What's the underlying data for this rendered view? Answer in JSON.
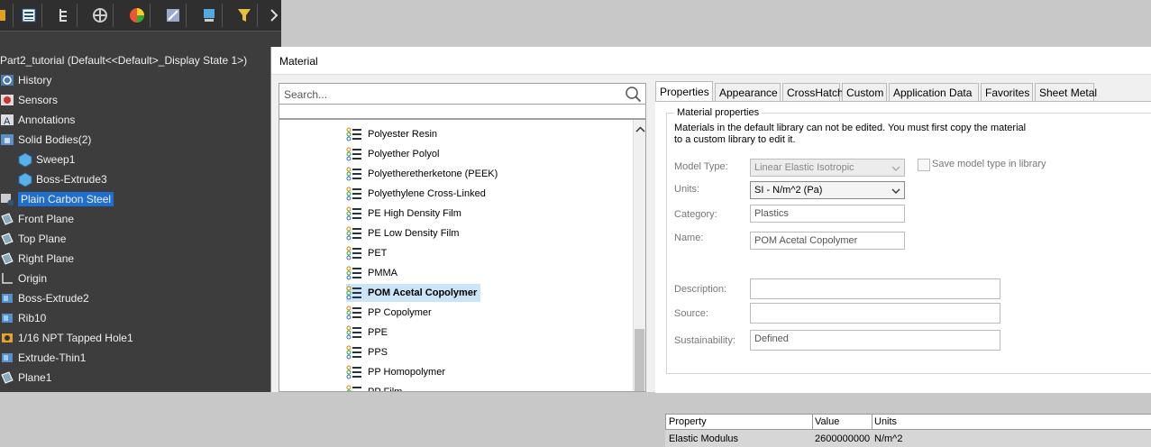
{
  "tree": {
    "part_title": "Part2_tutorial  (Default<<Default>_Display State 1>)",
    "items": [
      {
        "label": "History",
        "icon": "history-icon",
        "indent": 0
      },
      {
        "label": "Sensors",
        "icon": "sensor-icon",
        "indent": 0
      },
      {
        "label": "Annotations",
        "icon": "annotation-icon",
        "indent": 0
      },
      {
        "label": "Solid Bodies(2)",
        "icon": "solid-bodies-icon",
        "indent": 0
      },
      {
        "label": "Sweep1",
        "icon": "body-icon",
        "indent": 1
      },
      {
        "label": "Boss-Extrude3",
        "icon": "body-icon",
        "indent": 1
      },
      {
        "label": "Plain Carbon Steel",
        "icon": "material-icon",
        "indent": 0,
        "selected": true
      },
      {
        "label": "Front Plane",
        "icon": "plane-icon",
        "indent": 0
      },
      {
        "label": "Top Plane",
        "icon": "plane-icon",
        "indent": 0
      },
      {
        "label": "Right Plane",
        "icon": "plane-icon",
        "indent": 0
      },
      {
        "label": "Origin",
        "icon": "origin-icon",
        "indent": 0
      },
      {
        "label": "Boss-Extrude2",
        "icon": "feature-icon",
        "indent": 0
      },
      {
        "label": "Rib10",
        "icon": "feature-icon",
        "indent": 0
      },
      {
        "label": "1/16 NPT Tapped Hole1",
        "icon": "hole-icon",
        "indent": 0
      },
      {
        "label": "Extrude-Thin1",
        "icon": "feature-icon",
        "indent": 0
      },
      {
        "label": "Plane1",
        "icon": "plane-icon",
        "indent": 0
      }
    ]
  },
  "dialog": {
    "title": "Material",
    "search_placeholder": "Search...",
    "materials": [
      "Polyester Resin",
      "Polyether Polyol",
      "Polyetheretherketone (PEEK)",
      "Polyethylene Cross-Linked",
      "PE High Density Film",
      "PE Low Density Film",
      "PET",
      "PMMA",
      "POM Acetal Copolymer",
      "PP Copolymer",
      "PPE",
      "PPS",
      "PP Homopolymer",
      "PP Film"
    ],
    "selected_material": "POM Acetal Copolymer",
    "tabs": [
      "Properties",
      "Appearance",
      "CrossHatch",
      "Custom",
      "Application Data",
      "Favorites",
      "Sheet Metal"
    ],
    "active_tab": "Properties",
    "props": {
      "group_title": "Material properties",
      "note_line1": "Materials in the default library can not be edited. You must first copy the material",
      "note_line2": "to a custom library to edit it.",
      "model_type_label": "Model Type:",
      "model_type_value": "Linear Elastic Isotropic",
      "save_model_type_label": "Save model type in library",
      "units_label": "Units:",
      "units_value": "SI - N/m^2 (Pa)",
      "category_label": "Category:",
      "category_value": "Plastics",
      "name_label": "Name:",
      "name_value": "POM Acetal Copolymer",
      "description_label": "Description:",
      "description_value": "",
      "source_label": "Source:",
      "source_value": "",
      "sustainability_label": "Sustainability:",
      "sustainability_value": "Defined"
    },
    "grid": {
      "headers": [
        "Property",
        "Value",
        "Units"
      ],
      "row1": [
        "Elastic Modulus",
        "2600000000",
        "N/m^2"
      ]
    }
  },
  "colors": {
    "selection": "#1f6fd1",
    "list_selection": "#cce4f7",
    "panel_dark": "#3d3d3d"
  }
}
